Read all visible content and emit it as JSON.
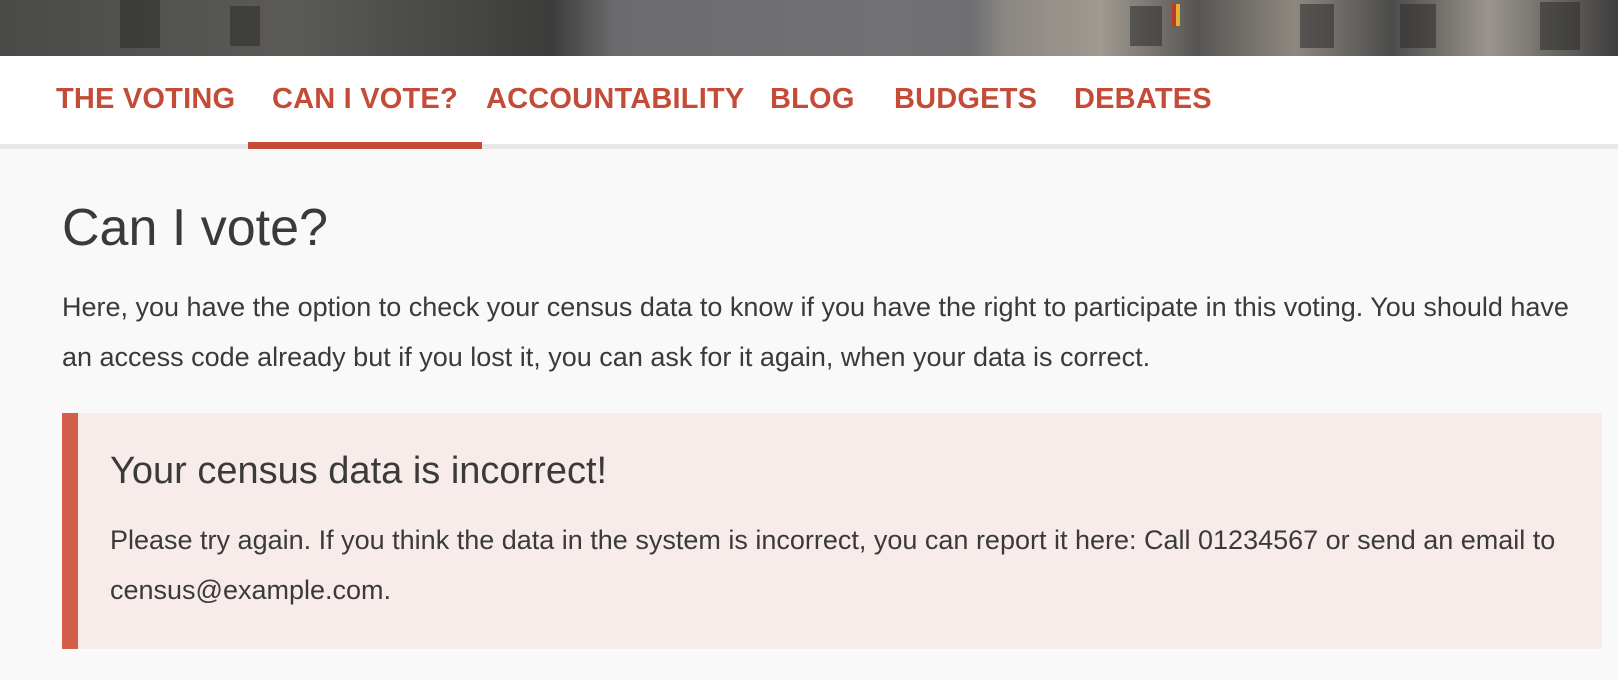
{
  "nav": {
    "items": [
      {
        "label": "THE VOTING"
      },
      {
        "label": "CAN I VOTE?"
      },
      {
        "label": "ACCOUNTABILITY"
      },
      {
        "label": "BLOG"
      },
      {
        "label": "BUDGETS"
      },
      {
        "label": "DEBATES"
      }
    ],
    "active_index": 1
  },
  "main": {
    "title": "Can I vote?",
    "intro": "Here, you have the option to check your census data to know if you have the right to participate in this voting. You should have an access code already but if you lost it, you can ask for it again, when your data is correct."
  },
  "alert": {
    "title": "Your census data is incorrect!",
    "message": "Please try again. If you think the data in the system is incorrect, you can report it here: Call 01234567 or send an email to census@example.com."
  },
  "colors": {
    "accent": "#c44b37",
    "alert_border": "#d45e4c",
    "alert_background": "#f8ecea",
    "page_background": "#f9f9f9",
    "text": "#3a3a3a"
  }
}
